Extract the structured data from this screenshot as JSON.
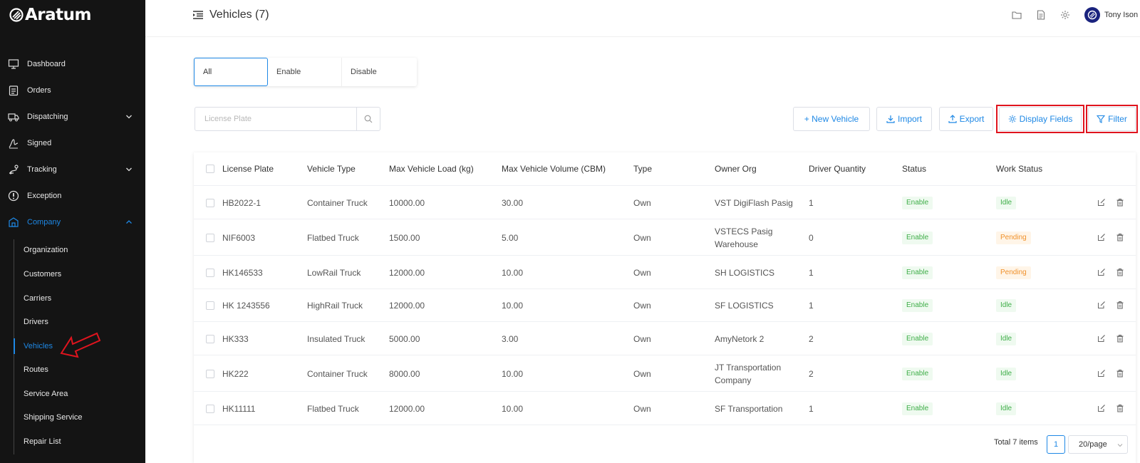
{
  "app": {
    "brand": "Aratum"
  },
  "sidebar": {
    "items": [
      {
        "label": "Dashboard",
        "icon": "monitor-icon"
      },
      {
        "label": "Orders",
        "icon": "clipboard-icon"
      },
      {
        "label": "Dispatching",
        "icon": "truck-icon",
        "expandable": true
      },
      {
        "label": "Signed",
        "icon": "signature-icon"
      },
      {
        "label": "Tracking",
        "icon": "route-icon",
        "expandable": true
      },
      {
        "label": "Exception",
        "icon": "alert-icon"
      },
      {
        "label": "Company",
        "icon": "building-icon",
        "expandable": true,
        "expanded": true,
        "active": true
      }
    ],
    "company_children": [
      {
        "label": "Organization"
      },
      {
        "label": "Customers"
      },
      {
        "label": "Carriers"
      },
      {
        "label": "Drivers"
      },
      {
        "label": "Vehicles",
        "active": true
      },
      {
        "label": "Routes"
      },
      {
        "label": "Service Area"
      },
      {
        "label": "Shipping Service"
      },
      {
        "label": "Repair List"
      }
    ]
  },
  "header": {
    "title": "Vehicles (7)",
    "user_name": "Tony Ison",
    "icons": [
      "folder-icon",
      "document-icon",
      "gear-icon"
    ]
  },
  "segment_tabs": [
    {
      "label": "All",
      "active": true
    },
    {
      "label": "Enable"
    },
    {
      "label": "Disable"
    }
  ],
  "search": {
    "placeholder": "License Plate",
    "value": ""
  },
  "toolbar": {
    "new_vehicle": "+ New Vehicle",
    "import": "Import",
    "export": "Export",
    "display_fields": "Display Fields",
    "filter": "Filter"
  },
  "table": {
    "columns": [
      "License Plate",
      "Vehicle Type",
      "Max Vehicle Load (kg)",
      "Max Vehicle Volume (CBM)",
      "Type",
      "Owner Org",
      "Driver Quantity",
      "Status",
      "Work Status"
    ],
    "rows": [
      {
        "plate": "HB2022-1",
        "vtype": "Container Truck",
        "load": "10000.00",
        "volume": "30.00",
        "type": "Own",
        "org": "VST DigiFlash Pasig",
        "drivers": "1",
        "status": "Enable",
        "work": "Idle"
      },
      {
        "plate": "NIF6003",
        "vtype": "Flatbed Truck",
        "load": "1500.00",
        "volume": "5.00",
        "type": "Own",
        "org": "VSTECS Pasig Warehouse",
        "drivers": "0",
        "status": "Enable",
        "work": "Pending"
      },
      {
        "plate": "HK146533",
        "vtype": "LowRail Truck",
        "load": "12000.00",
        "volume": "10.00",
        "type": "Own",
        "org": "SH LOGISTICS",
        "drivers": "1",
        "status": "Enable",
        "work": "Pending"
      },
      {
        "plate": "HK 1243556",
        "vtype": "HighRail Truck",
        "load": "12000.00",
        "volume": "10.00",
        "type": "Own",
        "org": "SF LOGISTICS",
        "drivers": "1",
        "status": "Enable",
        "work": "Idle"
      },
      {
        "plate": "HK333",
        "vtype": "Insulated Truck",
        "load": "5000.00",
        "volume": "3.00",
        "type": "Own",
        "org": "AmyNetork 2",
        "drivers": "2",
        "status": "Enable",
        "work": "Idle"
      },
      {
        "plate": "HK222",
        "vtype": "Container Truck",
        "load": "8000.00",
        "volume": "10.00",
        "type": "Own",
        "org": "JT Transportation Company",
        "drivers": "2",
        "status": "Enable",
        "work": "Idle"
      },
      {
        "plate": "HK11111",
        "vtype": "Flatbed Truck",
        "load": "12000.00",
        "volume": "10.00",
        "type": "Own",
        "org": "SF Transportation",
        "drivers": "1",
        "status": "Enable",
        "work": "Idle"
      }
    ]
  },
  "pagination": {
    "total": "Total 7 items",
    "page": "1",
    "page_size": "20/page"
  },
  "colors": {
    "accent": "#1e88e5",
    "sidebar_bg": "#141414",
    "success": "#3fae49",
    "warning": "#f0912b",
    "annotation_red": "#e0141e"
  }
}
